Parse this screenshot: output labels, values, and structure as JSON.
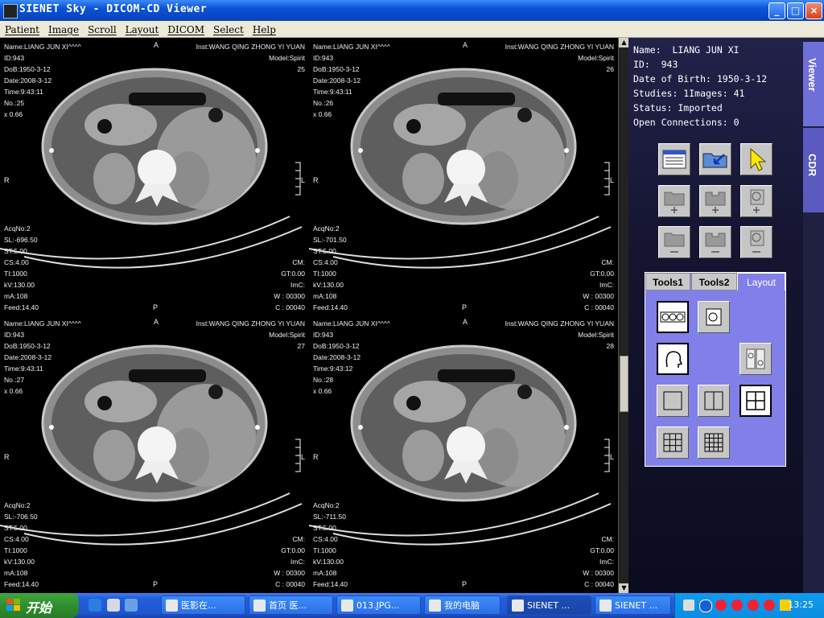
{
  "window": {
    "title": "SIENET Sky  - DICOM-CD Viewer",
    "buttons": {
      "minimize": "_",
      "maximize": "□",
      "close": "×"
    }
  },
  "menu": [
    "Patient",
    "Image",
    "Scroll",
    "Layout",
    "DICOM",
    "Select",
    "Help"
  ],
  "panes": [
    {
      "tl": "Name:LIANG JUN XI^^^^\nID:943\nDoB:1950-3-12\nDate:2008-3-12\nTime:9:43:11\nNo.:25\nx 0.66",
      "top_a": "A",
      "tr": "Inst:WANG QING ZHONG YI YUAN\nModel:Spirit\n25",
      "side_r": "R",
      "side_l": "L",
      "bottom_p": "P",
      "bl": "AcqNo:2\nSL:-696.50\nST:5.00\nCS:4.00\nTI:1000\nkV:130.00\nmA:108\nFeed:14.40",
      "br": "CM:\nGT:0.00\nImC:\nW : 00300\nC : 00040"
    },
    {
      "tl": "Name:LIANG JUN XI^^^^\nID:943\nDoB:1950-3-12\nDate:2008-3-12\nTime:9:43:11\nNo.:26\nx 0.66",
      "top_a": "A",
      "tr": "Inst:WANG QING ZHONG YI YUAN\nModel:Spirit\n26",
      "side_r": "R",
      "side_l": "L",
      "bottom_p": "P",
      "bl": "AcqNo:2\nSL:-701.50\nST:5.00\nCS:4.00\nTI:1000\nkV:130.00\nmA:108\nFeed:14.40",
      "br": "CM:\nGT:0.00\nImC:\nW : 00300\nC : 00040"
    },
    {
      "tl": "Name:LIANG JUN XI^^^^\nID:943\nDoB:1950-3-12\nDate:2008-3-12\nTime:9:43:11\nNo.:27\nx 0.66",
      "top_a": "A",
      "tr": "Inst:WANG QING ZHONG YI YUAN\nModel:Spirit\n27",
      "side_r": "R",
      "side_l": "L",
      "bottom_p": "P",
      "bl": "AcqNo:2\nSL:-706.50\nST:5.00\nCS:4.00\nTI:1000\nkV:130.00\nmA:108\nFeed:14.40",
      "br": "CM:\nGT:0.00\nImC:\nW : 00300\nC : 00040"
    },
    {
      "tl": "Name:LIANG JUN XI^^^^\nID:943\nDoB:1950-3-12\nDate:2008-3-12\nTime:9:43:12\nNo.:28\nx 0.66",
      "top_a": "A",
      "tr": "Inst:WANG QING ZHONG YI YUAN\nModel:Spirit\n28",
      "side_r": "R",
      "side_l": "L",
      "bottom_p": "P",
      "bl": "AcqNo:2\nSL:-711.50\nST:5.00\nCS:4.00\nTI:1000\nkV:130.00\nmA:108\nFeed:14.40",
      "br": "CM:\nGT:0.00\nImC:\nW : 00300\nC : 00040"
    }
  ],
  "patient_info": "Name:  LIANG JUN XI\nID:  943\nDate of Birth: 1950-3-12\nStudies: 1Images: 41\nStatus: Imported\nOpen Connections: 0",
  "tool_tabs": {
    "tab1": "Tools1",
    "tab2": "Tools2",
    "tab3": "Layout"
  },
  "side_tabs": {
    "viewer": "Viewer",
    "cdr": "CDR"
  },
  "taskbar": {
    "start_label": "开始",
    "tasks": [
      "医影在...",
      "首页 医...",
      "013.JPG...",
      "我的电脑",
      "SIENET ...",
      "SIENET ..."
    ],
    "clock": "13:25"
  },
  "colors": {
    "title_bar": "#0a53d8",
    "panel_bg": "#141430",
    "tab_area": "#8080e8",
    "side_tab": "#6f6fd8",
    "taskbar": "#245edb",
    "start_button": "#2f8f2f"
  }
}
